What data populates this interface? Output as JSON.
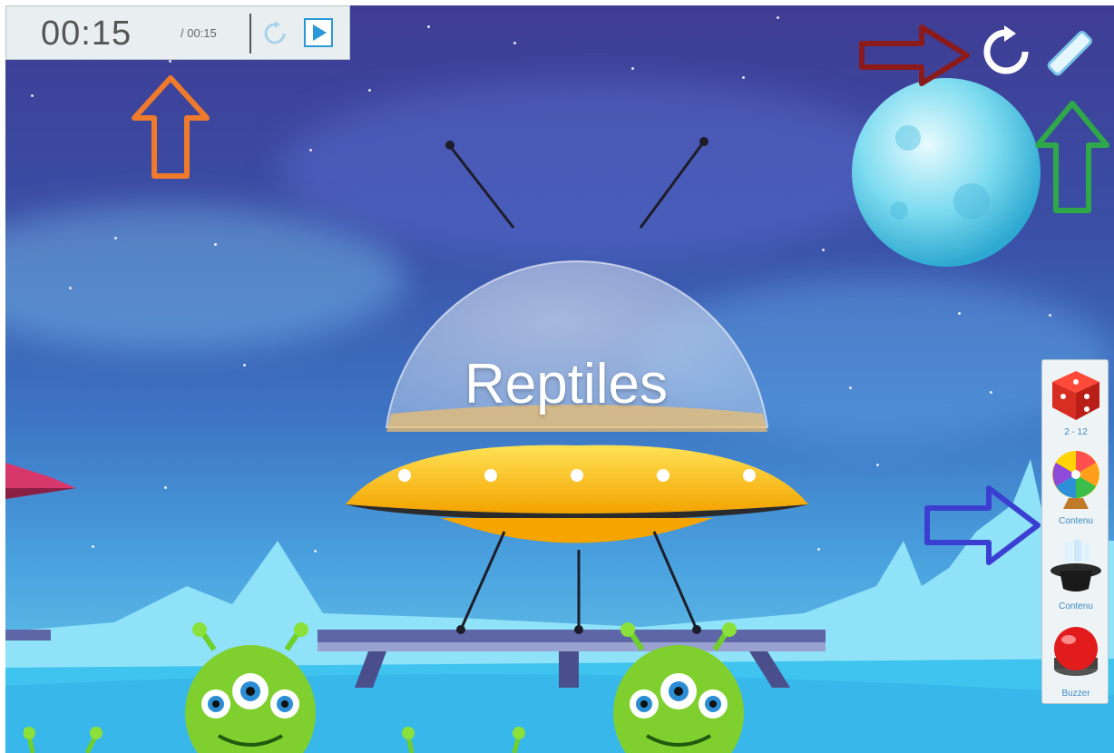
{
  "timer": {
    "elapsed": "00:15",
    "total": "/ 00:15",
    "reset_icon": "reset-icon",
    "play_icon": "play-icon"
  },
  "top_controls": {
    "restart_icon": "restart-icon",
    "pen_icon": "pen-icon"
  },
  "card": {
    "word": "Reptiles"
  },
  "tools": [
    {
      "icon": "dice-icon",
      "label": "2 - 12"
    },
    {
      "icon": "wheel-icon",
      "label": "Contenu"
    },
    {
      "icon": "hat-icon",
      "label": "Contenu"
    },
    {
      "icon": "buzzer-icon",
      "label": "Buzzer"
    }
  ],
  "annotations": {
    "orange_arrow_color": "#f07a2c",
    "red_arrow_color": "#8b1a1a",
    "green_arrow_color": "#2fa84a",
    "blue_arrow_color": "#3b3fd1"
  }
}
